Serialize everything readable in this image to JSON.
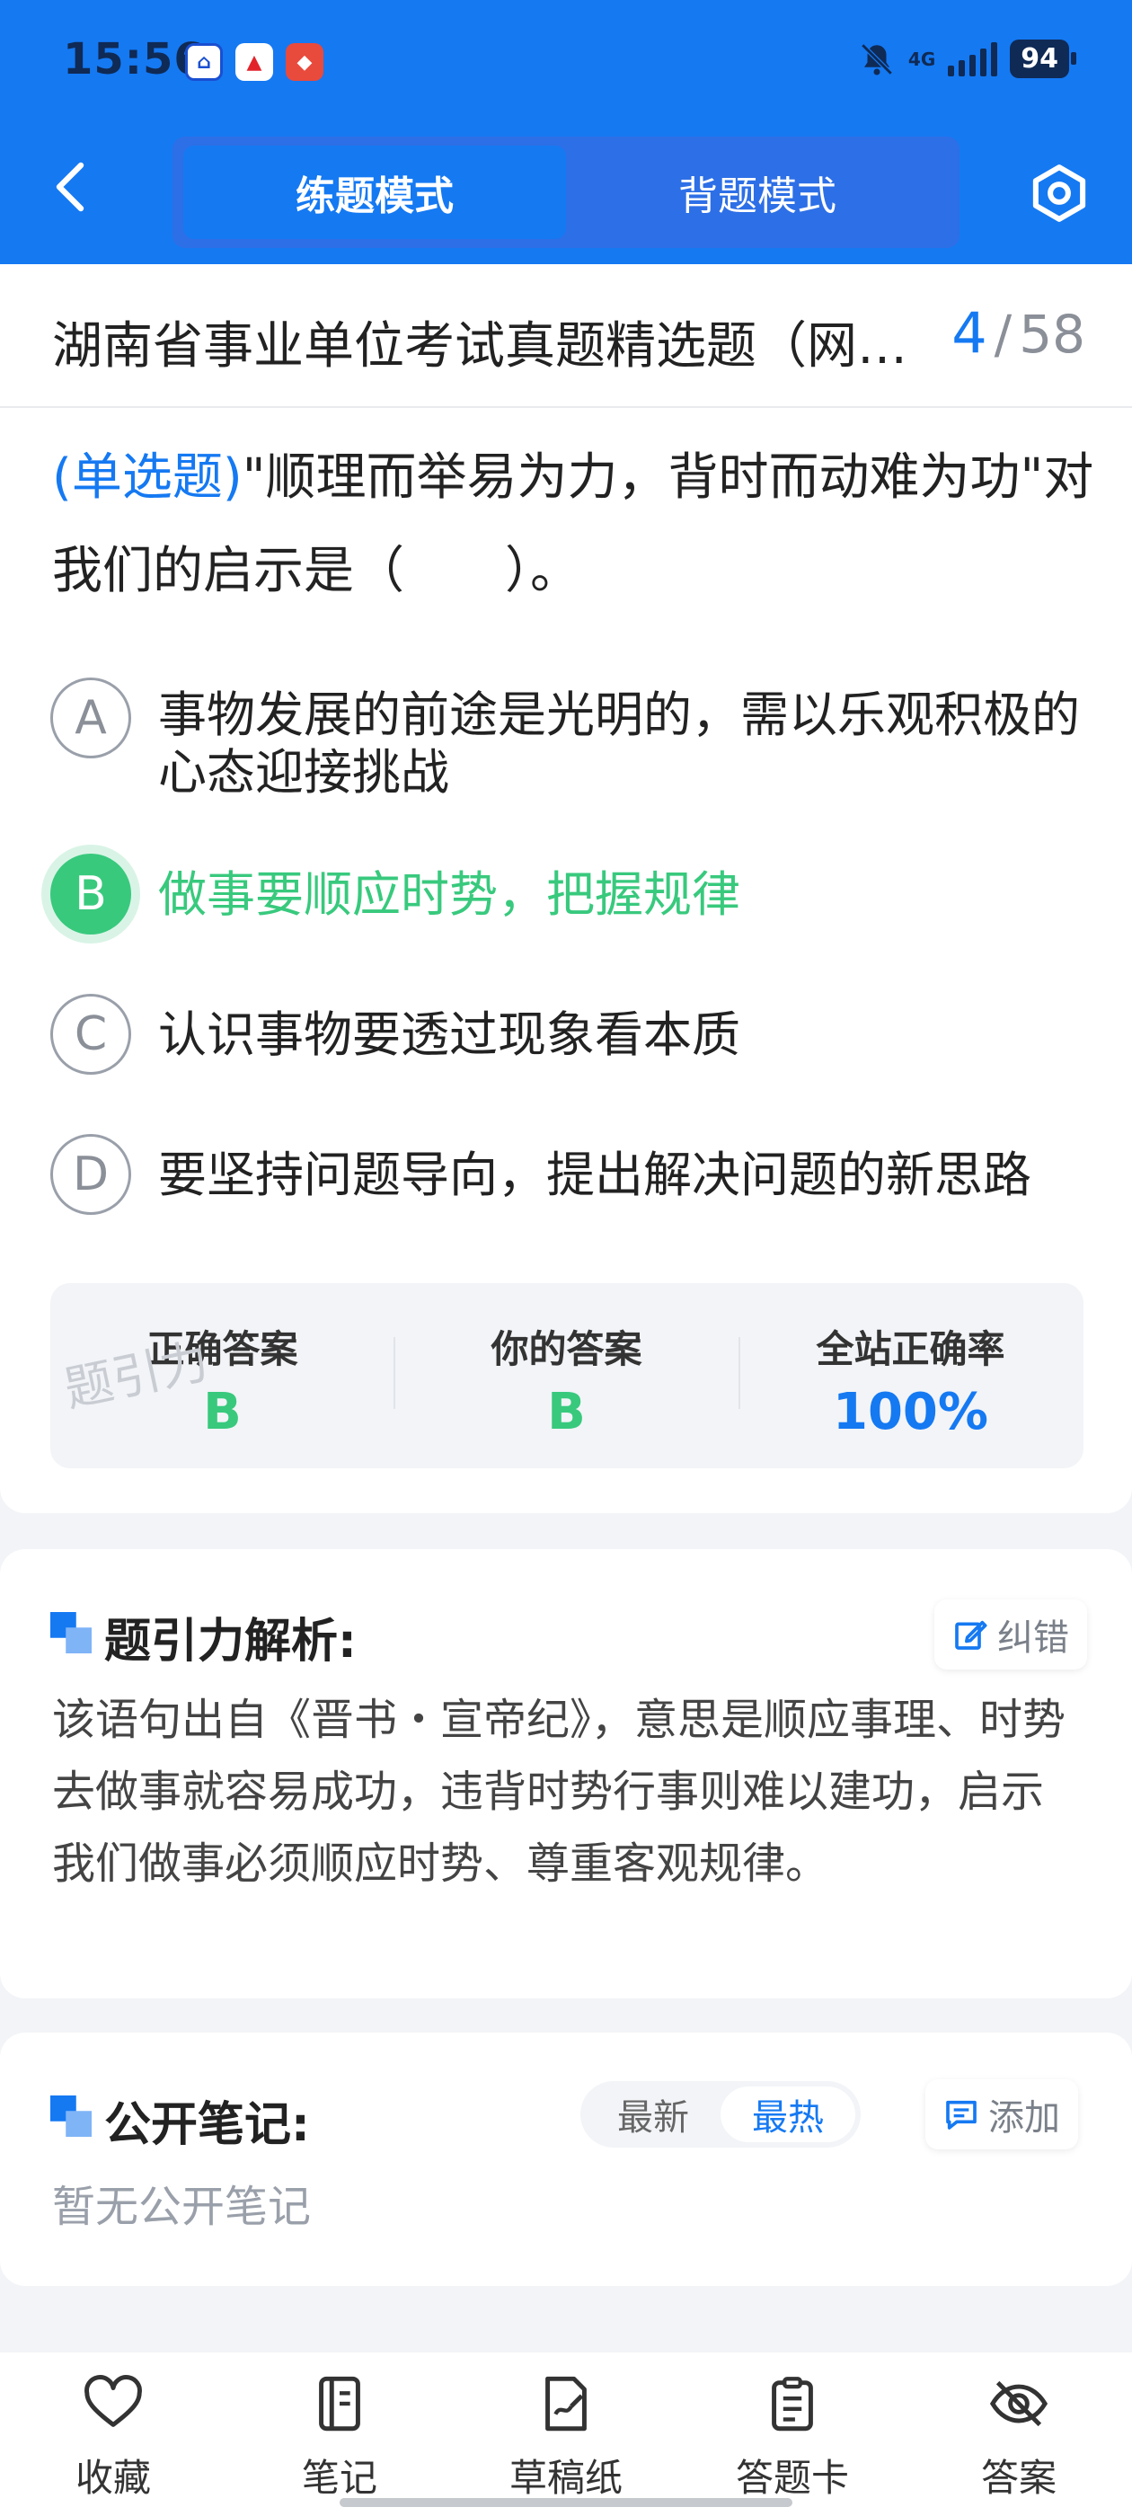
{
  "status_bar": {
    "time": "15:56",
    "network": "4G",
    "battery": "94"
  },
  "app_icons": [
    "app-icon-1",
    "app-icon-2",
    "app-icon-3"
  ],
  "header": {
    "tabs": [
      {
        "label": "练题模式",
        "active": true
      },
      {
        "label": "背题模式",
        "active": false
      }
    ]
  },
  "question": {
    "title": "湖南省事业单位考试真题精选题（网…",
    "current": "4",
    "separator": "/",
    "total": "58",
    "type": "(单选题)",
    "text": "\"顺理而举易为力，背时而动难为功\"对我们的启示是（　　）。",
    "options": [
      {
        "letter": "A",
        "text": "事物发展的前途是光明的，需以乐观积极的心态迎接挑战",
        "correct": false
      },
      {
        "letter": "B",
        "text": "做事要顺应时势，把握规律",
        "correct": true
      },
      {
        "letter": "C",
        "text": "认识事物要透过现象看本质",
        "correct": false
      },
      {
        "letter": "D",
        "text": "要坚持问题导向，提出解决问题的新思路",
        "correct": false
      }
    ],
    "answer_summary": {
      "correct_label": "正确答案",
      "correct_value": "B",
      "yours_label": "你的答案",
      "yours_value": "B",
      "rate_label": "全站正确率",
      "rate_value": "100%"
    },
    "watermark": "题引力"
  },
  "analysis": {
    "title": "题引力解析:",
    "report_label": "纠错",
    "text": "该语句出自《晋书・宣帝纪》，意思是顺应事理、时势去做事就容易成功，违背时势行事则难以建功，启示我们做事必须顺应时势、尊重客观规律。"
  },
  "notes": {
    "title": "公开笔记:",
    "sort_latest": "最新",
    "sort_hot": "最热",
    "add_label": "添加",
    "empty_text": "暂无公开笔记"
  },
  "bottom_nav": {
    "items": [
      {
        "label": "收藏",
        "icon": "heart-icon"
      },
      {
        "label": "笔记",
        "icon": "notebook-icon"
      },
      {
        "label": "草稿纸",
        "icon": "draft-paper-icon"
      },
      {
        "label": "答题卡",
        "icon": "answer-sheet-icon"
      },
      {
        "label": "答案",
        "icon": "eye-off-icon"
      }
    ]
  },
  "colors": {
    "brand_blue": "#1579f2",
    "correct_green": "#38c97d"
  }
}
